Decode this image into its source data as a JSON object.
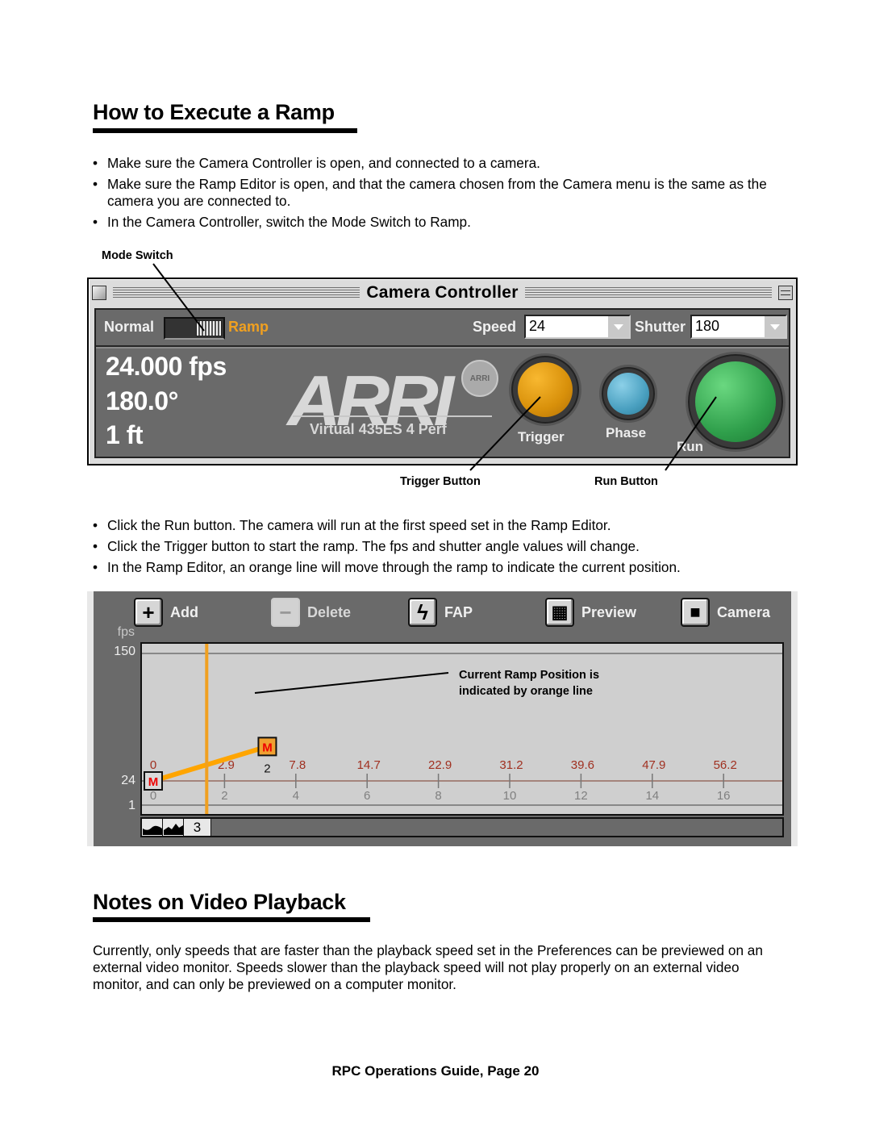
{
  "section1": {
    "title": "How to Execute a Ramp",
    "bullets_before": [
      "Make sure the Camera Controller is open, and connected to a camera.",
      "Make sure the Ramp Editor is open, and that the camera chosen from the Camera menu is the same as the camera you are connected to.",
      "In the Camera Controller, switch the Mode Switch to Ramp."
    ],
    "bullets_after": [
      "Click the Run button. The camera will run at the first speed set in the Ramp Editor.",
      "Click the Trigger button to start the ramp. The fps and shutter angle values will change.",
      "In the Ramp Editor, an orange line will move through the ramp to indicate the current position."
    ],
    "bullet_glyph": "•"
  },
  "callouts": {
    "mode_switch": "Mode Switch",
    "trigger_button": "Trigger Button",
    "run_button": "Run Button",
    "current_position": [
      "Current Ramp Position is",
      "indicated by orange line"
    ]
  },
  "camera_controller": {
    "title": "Camera Controller",
    "mode_normal": "Normal",
    "mode_ramp": "Ramp",
    "mode_selected": "Ramp",
    "speed_label": "Speed",
    "speed_value": "24",
    "shutter_label": "Shutter",
    "shutter_value": "180",
    "fps_readout": "24.000 fps",
    "shutter_readout": "180.0°",
    "footage_readout": "1 ft",
    "logo": "ARRI",
    "seal": "ARRI",
    "camera_model": "Virtual 435ES 4 Perf",
    "trigger_label": "Trigger",
    "phase_label": "Phase",
    "run_label": "Run",
    "colors": {
      "trigger": "#e8a010",
      "phase": "#4aa8c8",
      "run": "#2ea04a",
      "ramp_label": "#f0a020"
    }
  },
  "ramp_editor": {
    "toolbar": [
      {
        "label": "Add",
        "icon": "plus-icon",
        "glyph": "+",
        "enabled": true
      },
      {
        "label": "Delete",
        "icon": "minus-icon",
        "glyph": "−",
        "enabled": false
      },
      {
        "label": "FAP",
        "icon": "lightning-icon",
        "glyph": "ϟ",
        "enabled": true
      },
      {
        "label": "Preview",
        "icon": "film-strip-icon",
        "glyph": "▦",
        "enabled": true
      },
      {
        "label": "Camera",
        "icon": "video-camera-icon",
        "glyph": "■",
        "enabled": true
      }
    ],
    "strip_value": "3",
    "colors": {
      "ramp_line": "#ffa500",
      "position_line": "#f0a020",
      "frame_labels": "#a03020",
      "time_labels": "#808080"
    }
  },
  "chart_data": {
    "type": "line",
    "title": "",
    "ylabel": "fps",
    "xlabel": "",
    "y_ticks": [
      1,
      24,
      150
    ],
    "ylim": [
      1,
      150
    ],
    "x_ticks": [
      0,
      2,
      4,
      6,
      8,
      10,
      12,
      14,
      16
    ],
    "xlim": [
      0,
      17.8
    ],
    "frame_labels": [
      "0",
      "2.9",
      "7.8",
      "14.7",
      "22.9",
      "31.2",
      "39.6",
      "47.9",
      "56.2",
      "1"
    ],
    "series": [
      {
        "name": "ramp",
        "points": [
          {
            "x": 0,
            "y": 24
          },
          {
            "x": 3.2,
            "y": 58
          }
        ]
      }
    ],
    "keyframes": [
      {
        "label": "M",
        "index": "",
        "x": 0,
        "y": 24
      },
      {
        "label": "M",
        "index": "2",
        "x": 3.2,
        "y": 58
      }
    ],
    "current_position_x": 1.5,
    "grid": false
  },
  "section2": {
    "title": "Notes on Video Playback",
    "body": "Currently, only speeds that are faster than the playback speed set in the Preferences can be previewed on an external video monitor. Speeds slower than the playback speed will not play properly on an external video monitor, and can only be previewed on a computer monitor."
  },
  "footer": "RPC Operations Guide, Page 20"
}
